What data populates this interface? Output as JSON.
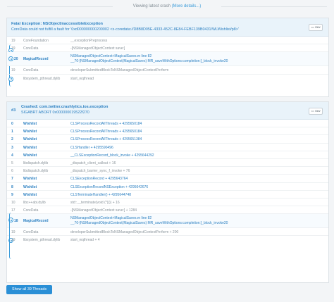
{
  "banner": {
    "label": "Viewing latest crash",
    "link": "(More details...)"
  },
  "panel1": {
    "title": "Fatal Exception: NSObjectInaccessibleException",
    "subtitle": "CoreData could not fulfill a fault for '0xd000000000200002 <x-coredata://D8B8D05E-4333-452C-8E84-FEBF139B0431/WLWishlist/p8>'",
    "raw_label": "raw",
    "rows": [
      {
        "num": "19",
        "lib": "CoreFoundation",
        "sym": "__exceptionPreprocess"
      },
      {
        "num": "19",
        "lib": "CoreData",
        "sym": "-[NSManagedObjectContext save:]"
      },
      {
        "num": "20",
        "lib": "MagicalRecord",
        "sym1": "NSManagedObjectContext+MagicalSaves.m line 82",
        "sym2": "__70-[NSManagedObjectContext(MagicalSaves) MR_saveWithOptions:completion:]_block_invoke20"
      },
      {
        "num": "19",
        "lib": "CoreData",
        "sym": "developerSubmittedBlockToNSManagedObjectContextPerform"
      },
      {
        "num": "",
        "lib": "libsystem_pthread.dylib",
        "sym": "start_wqthread"
      }
    ]
  },
  "panel2": {
    "thread_no": "#3",
    "title": "Crashed: com.twitter.crashlytics.ios.exception",
    "subtitle": "SIGABRT ABORT 0x000000019522f270",
    "raw_label": "raw",
    "rows": [
      {
        "num": "0",
        "lib": "Wishlist",
        "sym": "CLSProcessRecordAllThreads + 4295650184",
        "app": true
      },
      {
        "num": "1",
        "lib": "Wishlist",
        "sym": "CLSProcessRecordAllThreads + 4295650184",
        "app": true
      },
      {
        "num": "2",
        "lib": "Wishlist",
        "sym": "CLSProcessRecordAllThreads + 4295651384",
        "app": true
      },
      {
        "num": "3",
        "lib": "Wishlist",
        "sym": "CLSHandler + 4295590496",
        "app": true
      },
      {
        "num": "4",
        "lib": "Wishlist",
        "sym": "__CLSExceptionRecord_block_invoke + 4295644292",
        "app": true
      },
      {
        "num": "5",
        "lib": "libdispatch.dylib",
        "sym": "_dispatch_client_callout + 16",
        "app": false
      },
      {
        "num": "6",
        "lib": "libdispatch.dylib",
        "sym": "_dispatch_barrier_sync_f_invoke + 76",
        "app": false
      },
      {
        "num": "7",
        "lib": "Wishlist",
        "sym": "CLSExceptionRecord + 4295643764",
        "app": true
      },
      {
        "num": "8",
        "lib": "Wishlist",
        "sym": "CLSExceptionRecordNSException + 4295642676",
        "app": true
      },
      {
        "num": "9",
        "lib": "Wishlist",
        "sym": "CLSTerminateHandler() + 4295644748",
        "app": true
      },
      {
        "num": "10",
        "lib": "libc++abi.dylib",
        "sym": "std::__terminate(void (*)()) + 16",
        "app": false
      },
      {
        "num": "17",
        "lib": "CoreData",
        "sym": "-[NSManagedObjectContext save:] + 1284",
        "app": false
      },
      {
        "num": "18",
        "lib": "MagicalRecord",
        "sym1": "NSManagedObjectContext+MagicalSaves.m line 82",
        "sym2": "__70-[NSManagedObjectContext(MagicalSaves) MR_saveWithOptions:completion:]_block_invoke20",
        "app": true,
        "tall": true
      },
      {
        "num": "19",
        "lib": "CoreData",
        "sym": "developerSubmittedBlockToNSManagedObjectContextPerform + 200",
        "app": false
      },
      {
        "num": "19",
        "lib": "libsystem_pthread.dylib",
        "sym": "start_wqthread + 4",
        "app": false
      }
    ]
  },
  "show_all": "Show all 39 Threads",
  "colors": {
    "accent": "#2a7fc1",
    "button": "#2a8fd6",
    "header_bg": "#e9f3fa"
  }
}
